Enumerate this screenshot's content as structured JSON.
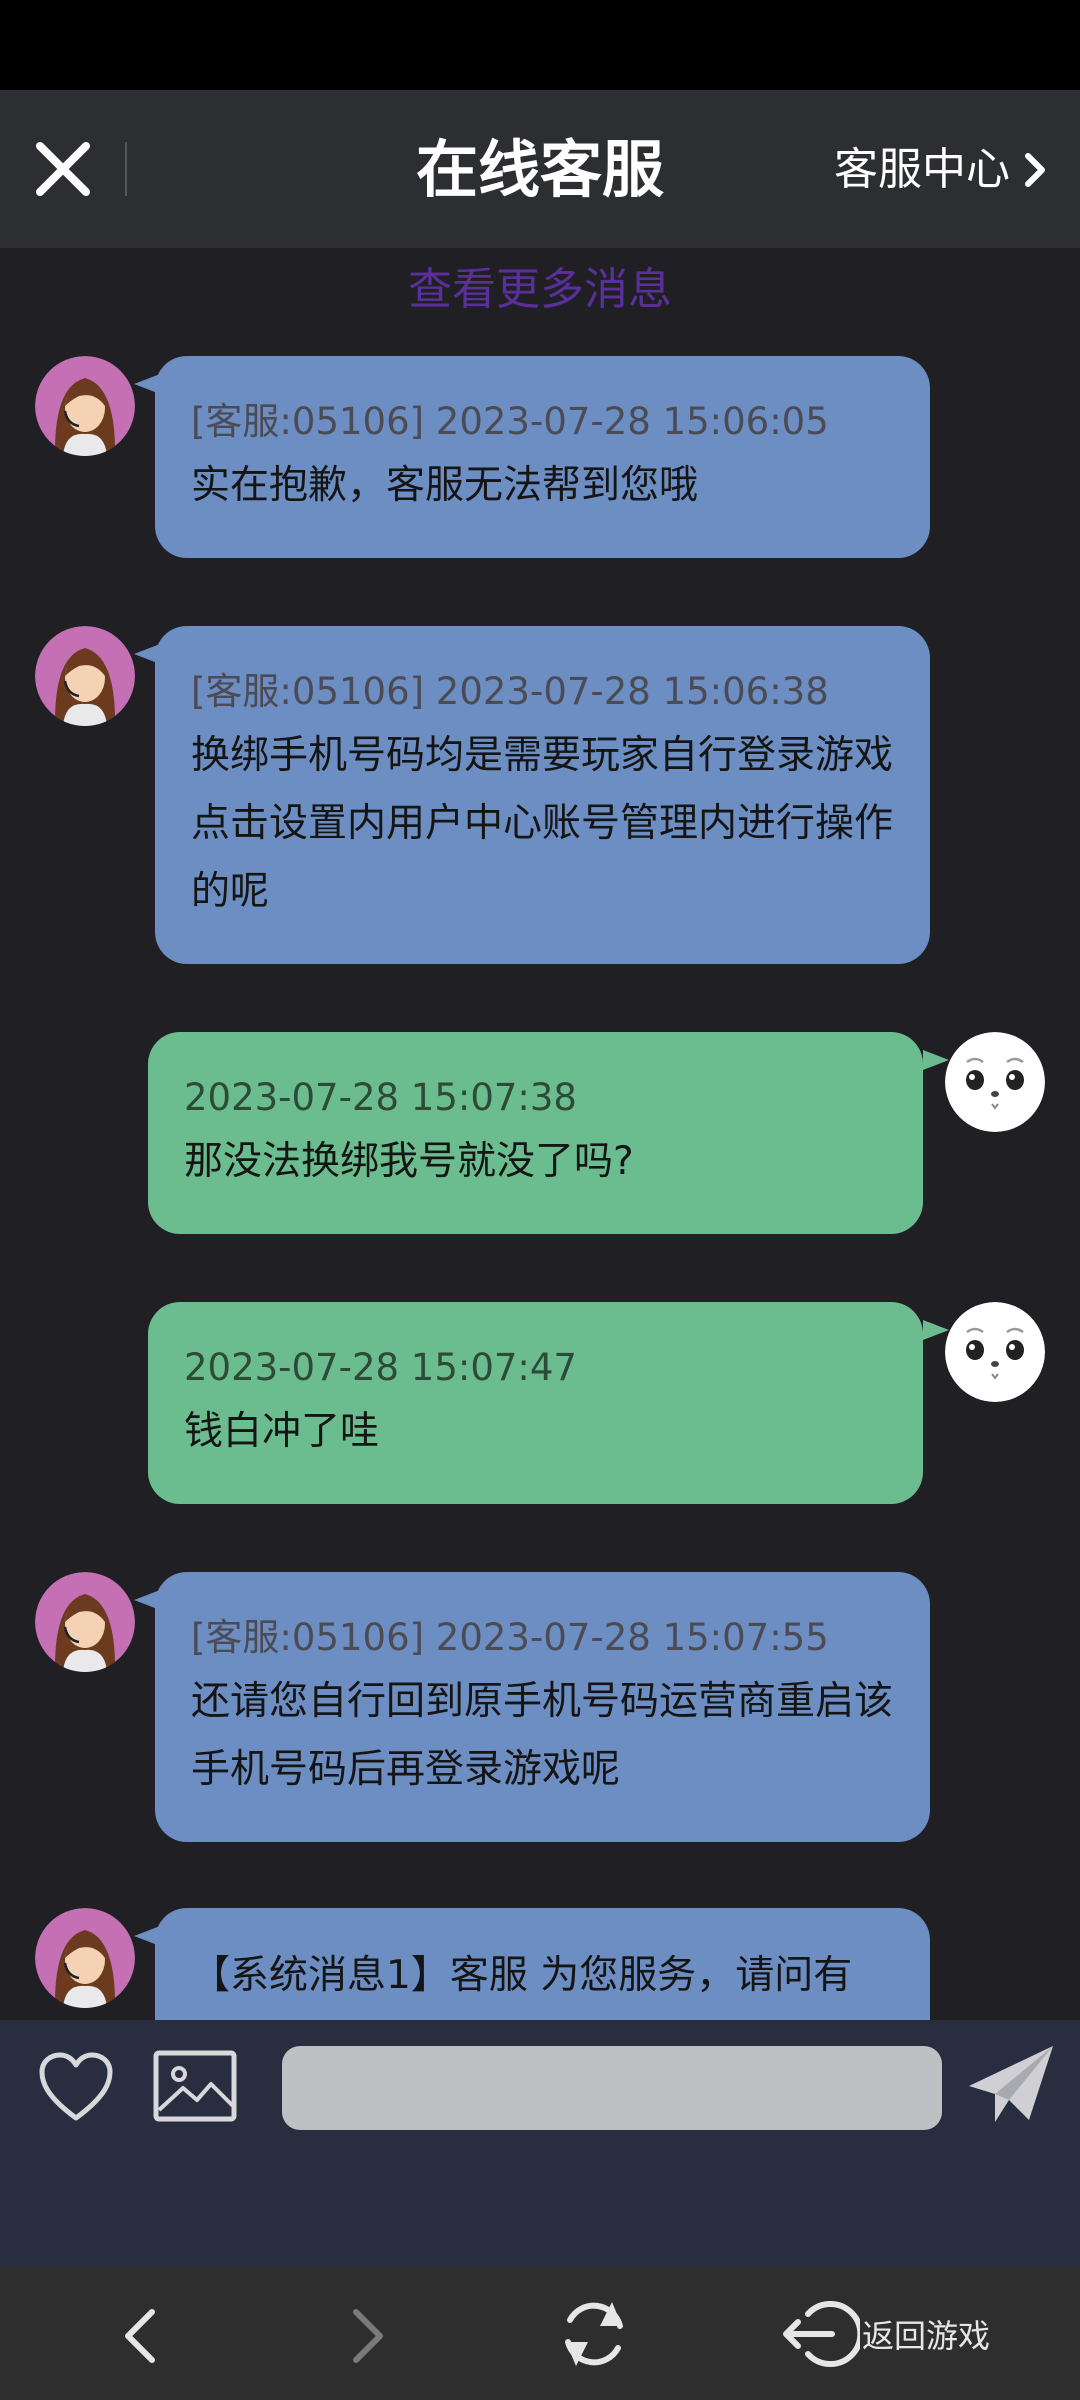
{
  "header": {
    "title": "在线客服",
    "service_center": "客服中心"
  },
  "chat": {
    "more_messages": "查看更多消息",
    "messages": [
      {
        "from": "agent",
        "meta": "[客服:05106] 2023-07-28 15:06:05",
        "text": "实在抱歉，客服无法帮到您哦"
      },
      {
        "from": "agent",
        "meta": "[客服:05106] 2023-07-28 15:06:38",
        "text": "换绑手机号码均是需要玩家自行登录游戏点击设置内用户中心账号管理内进行操作的呢"
      },
      {
        "from": "user",
        "meta": "2023-07-28 15:07:38",
        "text": "那没法换绑我号就没了吗?"
      },
      {
        "from": "user",
        "meta": "2023-07-28 15:07:47",
        "text": "钱白冲了哇"
      },
      {
        "from": "agent",
        "meta": "[客服:05106] 2023-07-28 15:07:55",
        "text": "还请您自行回到原手机号码运营商重启该手机号码后再登录游戏呢"
      },
      {
        "from": "agent",
        "meta": "",
        "text": "【系统消息1】客服 为您服务，请问有"
      }
    ]
  },
  "input": {
    "value": "",
    "placeholder": ""
  },
  "nav": {
    "return_label": "返回游戏"
  },
  "colors": {
    "agent_bubble": "#6d8ec2",
    "user_bubble": "#6bbc8e",
    "link": "#5a2f9a"
  }
}
